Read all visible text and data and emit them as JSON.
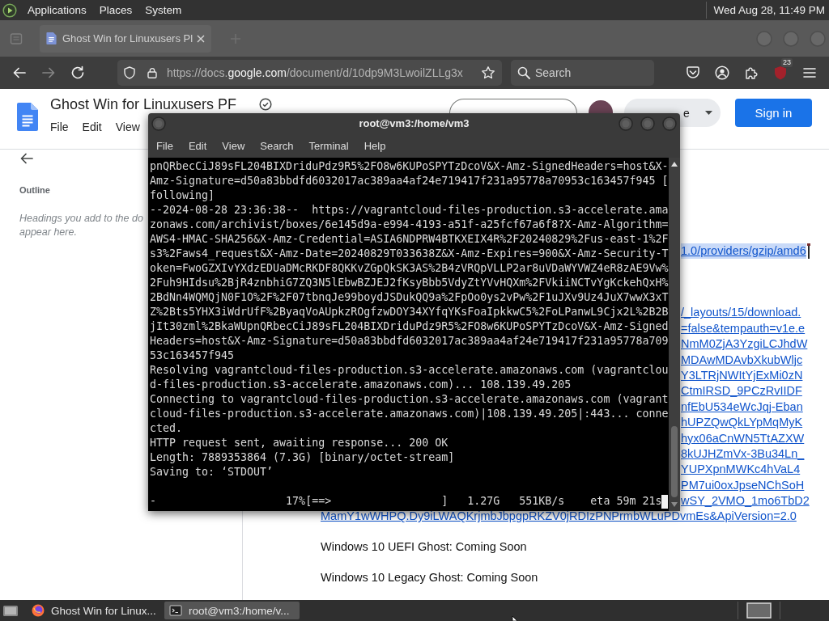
{
  "top_panel": {
    "menus": [
      "Applications",
      "Places",
      "System"
    ],
    "clock": "Wed Aug 28, 11:49 PM"
  },
  "browser": {
    "tabs": [
      {
        "title": "Ghost Win for Linuxusers Pl"
      }
    ],
    "nav_buttons": [
      {
        "kind": "back",
        "disabled": false
      },
      {
        "kind": "forward",
        "disabled": true
      },
      {
        "kind": "reload",
        "disabled": false
      }
    ],
    "url": {
      "start": "https://docs.",
      "domain": "google.com",
      "rest": "/document/d/10dp9M3LwoilZLLg3x"
    },
    "search": {
      "placeholder": "Search"
    },
    "extension_badge": "23"
  },
  "docs": {
    "title": "Ghost Win for Linuxusers PF",
    "menu": [
      "File",
      "Edit",
      "View"
    ],
    "dropdown_label": "e",
    "sign_in": "Sign in",
    "outline": {
      "heading": "Outline",
      "hint_lines": [
        "Headings you add to the do",
        "appear here."
      ]
    },
    "link_blocks": [
      {
        "lines": [
          {
            "kind": "fragment",
            "text": "1.0/providers/gzip/amd6",
            "selected": true
          }
        ]
      },
      {
        "lines": [
          {
            "kind": "fragment",
            "text": "/_layouts/15/download.",
            "selected": false
          },
          {
            "kind": "fragment",
            "text": "=false&tempauth=v1e.e",
            "selected": false
          },
          {
            "kind": "fragment",
            "text": "NmM0ZjA3YzgiLCJhdW",
            "selected": false
          },
          {
            "kind": "fragment",
            "text": "MDAwMDAvbXkubWljc",
            "selected": false
          },
          {
            "kind": "fragment",
            "text": "Y3LTRjNWItYjExMi0zN",
            "selected": false
          },
          {
            "kind": "fragment",
            "text": "CtmIRSD_9PCzRvIIDF",
            "selected": false
          },
          {
            "kind": "fragment",
            "text": "nfEbU534eWcJqj-Eban",
            "selected": false
          },
          {
            "kind": "fragment",
            "text": "hUPZQwQkLYpMqMyK",
            "selected": false
          },
          {
            "kind": "fragment",
            "text": "hyx06aCnWN5TtAZXW",
            "selected": false
          },
          {
            "kind": "fragment",
            "text": "8kUJHZmVx-3Bu34Ln_",
            "selected": false
          },
          {
            "kind": "fragment",
            "text": "YUPXpnMWKc4hVaL4",
            "selected": false
          },
          {
            "kind": "fragment",
            "text": "PM7ui0oxJpseNChSoH",
            "selected": false
          },
          {
            "kind": "fragment",
            "text": "wSY_2VMO_1mo6TbD2",
            "selected": false
          },
          {
            "kind": "line",
            "text": "MamY1wWHPQ.Dy9iLWAQKrjmbJbpgpRKZV0jRDIzPNPrmbWLuPDvmEs&ApiVersion=2.0",
            "selected": false
          }
        ]
      }
    ],
    "paragraphs": [
      "Windows 10 UEFI Ghost: Coming Soon",
      "Windows 10 Legacy Ghost: Coming Soon"
    ]
  },
  "terminal": {
    "title": "root@vm3:/home/vm3",
    "menu": [
      "File",
      "Edit",
      "View",
      "Search",
      "Terminal",
      "Help"
    ],
    "lines": [
      "pnQRbecCiJ89sFL204BIXDriduPdz9R5%2FO8w6KUPoSPYTzDcoV&X-Amz-SignedHeaders=host&X-",
      "Amz-Signature=d50a83bbdfd6032017ac389aa4af24e719417f231a95778a70953c163457f945 [",
      "following]",
      "--2024-08-28 23:36:38--  https://vagrantcloud-files-production.s3-accelerate.ama",
      "zonaws.com/archivist/boxes/6e145d9a-e994-4193-a51f-a25fcf67a6f8?X-Amz-Algorithm=",
      "AWS4-HMAC-SHA256&X-Amz-Credential=ASIA6NDPRW4BTKXEIX4R%2F20240829%2Fus-east-1%2F",
      "s3%2Faws4_request&X-Amz-Date=20240829T033638Z&X-Amz-Expires=900&X-Amz-Security-T",
      "oken=FwoGZXIvYXdzEDUaDMcRKDF8QKKvZGpQkSK3AS%2B4zVRQpVLLP2ar8uVDaWYVWZ4eR8zAE9Vw%",
      "2Fuh9HIdsu%2BjR4znbhiG7ZQ3N5lEbwBZJEJ2fKsyBbb5VdyZtYVvHQXm%2FVkiiNCTvYgKckehQxH%",
      "2BdNn4WQMQjN0F1O%2F%2F07tbnqJe99boydJSDukQQ9a%2FpOo0ys2vPw%2F1uJXv9Uz4JuX7wwX3xT",
      "Z%2Bts5YHX3iWdrUfF%2ByaqVoAUpkzROgfzwDOY34XYfqYKsFoaIpkkwC5%2FoLPanwL9Cjx2L%2B2B",
      "jIt30zml%2BkaWUpnQRbecCiJ89sFL204BIXDriduPdz9R5%2FO8w6KUPoSPYTzDcoV&X-Amz-Signed",
      "Headers=host&X-Amz-Signature=d50a83bbdfd6032017ac389aa4af24e719417f231a95778a709",
      "53c163457f945",
      "Resolving vagrantcloud-files-production.s3-accelerate.amazonaws.com (vagrantclou",
      "d-files-production.s3-accelerate.amazonaws.com)... 108.139.49.205",
      "Connecting to vagrantcloud-files-production.s3-accelerate.amazonaws.com (vagrant",
      "cloud-files-production.s3-accelerate.amazonaws.com)|108.139.49.205|:443... conne",
      "cted.",
      "HTTP request sent, awaiting response... 200 OK",
      "Length: 7889353864 (7.3G) [binary/octet-stream]",
      "Saving to: ‘STDOUT’"
    ],
    "progress": "-                    17%[==>                 ]   1.27G   551KB/s    eta 59m 21s"
  },
  "taskbar": {
    "tasks": [
      {
        "kind": "browser",
        "title": "Ghost Win for Linux...",
        "selected": false
      },
      {
        "kind": "terminal",
        "title": "root@vm3:/home/v...",
        "selected": true
      }
    ]
  }
}
